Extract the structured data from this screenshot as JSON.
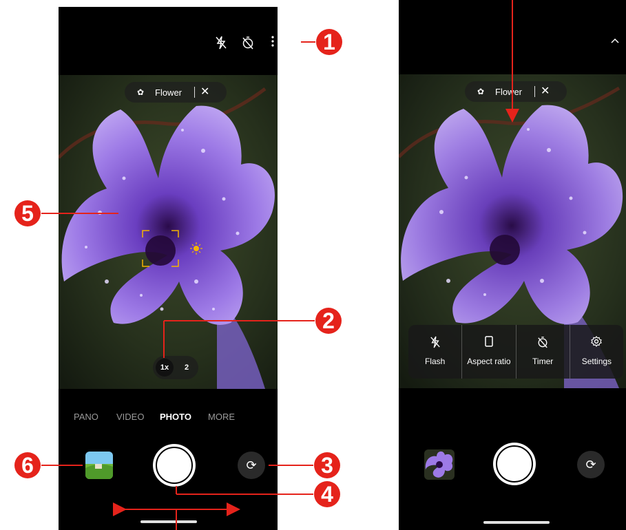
{
  "left_screen": {
    "scene_chip": {
      "label": "Flower"
    },
    "zoom": {
      "option_1": "1x",
      "option_2": "2"
    },
    "modes": [
      "PANO",
      "VIDEO",
      "PHOTO",
      "MORE"
    ],
    "active_mode": "PHOTO"
  },
  "right_screen": {
    "scene_chip": {
      "label": "Flower"
    },
    "menu": [
      {
        "label": "Flash",
        "icon": "flash-off-icon"
      },
      {
        "label": "Aspect ratio",
        "icon": "aspect-ratio-icon"
      },
      {
        "label": "Timer",
        "icon": "timer-off-icon"
      },
      {
        "label": "Settings",
        "icon": "settings-icon"
      }
    ]
  },
  "callouts": {
    "c1": "1",
    "c2": "2",
    "c3": "3",
    "c4": "4",
    "c5": "5",
    "c6": "6"
  },
  "colors": {
    "callout": "#e5231b",
    "focus_box": "#f5b400",
    "background": "#000000"
  }
}
